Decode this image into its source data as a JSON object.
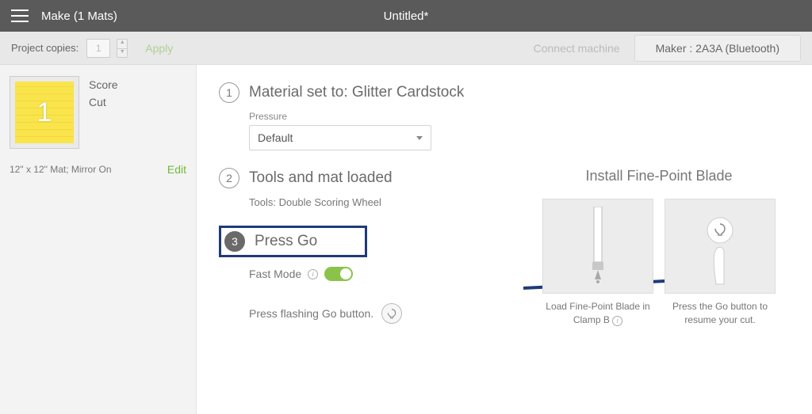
{
  "topbar": {
    "title": "Make (1 Mats)",
    "doc": "Untitled*"
  },
  "subbar": {
    "copies_label": "Project copies:",
    "copies_value": "1",
    "apply": "Apply",
    "connect": "Connect machine",
    "machine": "Maker : 2A3A (Bluetooth)"
  },
  "sidebar": {
    "mat_number": "1",
    "op1": "Score",
    "op2": "Cut",
    "meta": "12\" x 12\" Mat; Mirror On",
    "edit": "Edit"
  },
  "steps": {
    "s1": {
      "num": "1",
      "title": "Material set to: Glitter Cardstock",
      "pressure_label": "Pressure",
      "pressure_value": "Default"
    },
    "s2": {
      "num": "2",
      "title": "Tools and mat loaded",
      "tools": "Tools: Double Scoring Wheel"
    },
    "s3": {
      "num": "3",
      "title": "Press Go",
      "fastmode": "Fast Mode",
      "instruction": "Press flashing Go button."
    }
  },
  "right": {
    "title": "Install Fine-Point Blade",
    "card1": "Load Fine-Point Blade in Clamp B",
    "card2": "Press the Go button to resume your cut."
  }
}
